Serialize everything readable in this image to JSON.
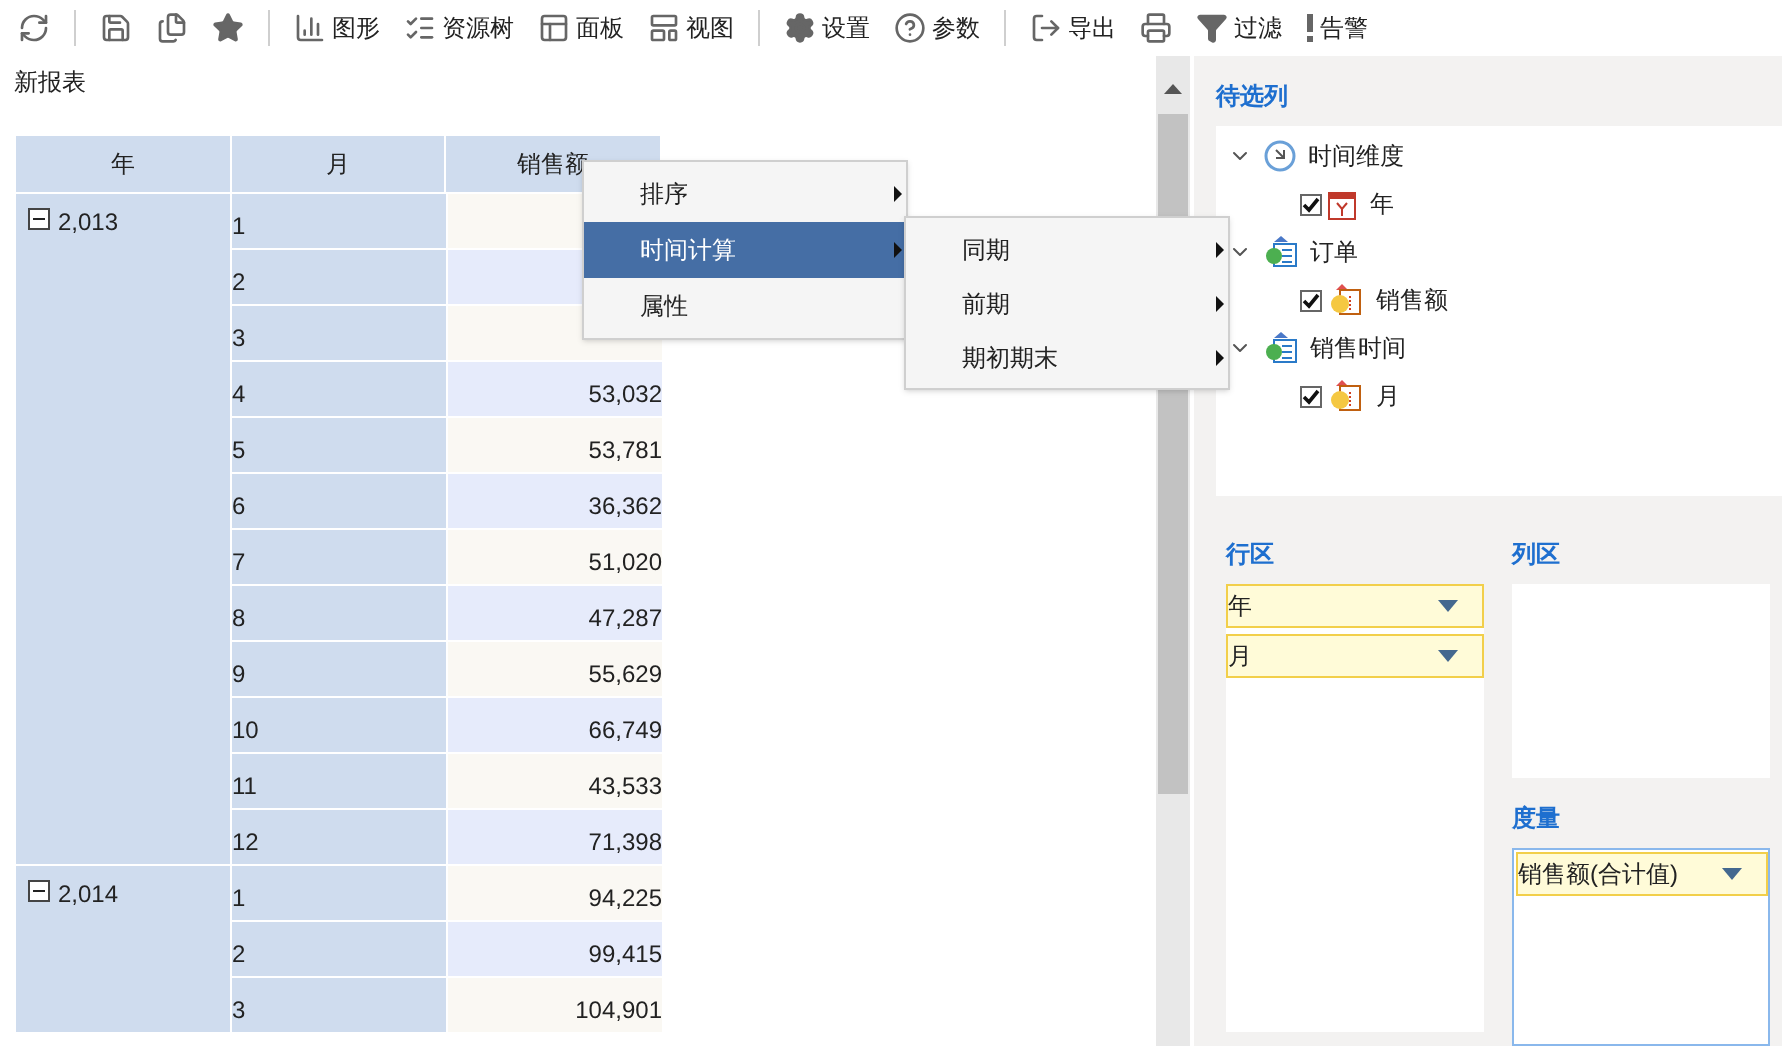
{
  "toolbar": [
    {
      "kind": "refresh"
    },
    {
      "kind": "divider"
    },
    {
      "kind": "save"
    },
    {
      "kind": "save_as"
    },
    {
      "kind": "favorite"
    },
    {
      "kind": "divider"
    },
    {
      "kind": "chart",
      "label": "图形"
    },
    {
      "kind": "tree",
      "label": "资源树"
    },
    {
      "kind": "panel",
      "label": "面板"
    },
    {
      "kind": "view",
      "label": "视图"
    },
    {
      "kind": "divider"
    },
    {
      "kind": "settings",
      "label": "设置"
    },
    {
      "kind": "params",
      "label": "参数"
    },
    {
      "kind": "divider"
    },
    {
      "kind": "export",
      "label": "导出"
    },
    {
      "kind": "print"
    },
    {
      "kind": "filter",
      "label": "过滤"
    },
    {
      "kind": "alert",
      "label": "告警"
    }
  ],
  "report_title": "新报表",
  "table": {
    "columns": [
      "年",
      "月",
      "销售额"
    ],
    "groups": [
      {
        "year": "2,013",
        "expanded": true,
        "rows": [
          {
            "month": "1"
          },
          {
            "month": "2"
          },
          {
            "month": "3"
          },
          {
            "month": "4",
            "value": "53,032"
          },
          {
            "month": "5",
            "value": "53,781"
          },
          {
            "month": "6",
            "value": "36,362"
          },
          {
            "month": "7",
            "value": "51,020"
          },
          {
            "month": "8",
            "value": "47,287"
          },
          {
            "month": "9",
            "value": "55,629"
          },
          {
            "month": "10",
            "value": "66,749"
          },
          {
            "month": "11",
            "value": "43,533"
          },
          {
            "month": "12",
            "value": "71,398"
          }
        ]
      },
      {
        "year": "2,014",
        "expanded": true,
        "rows": [
          {
            "month": "1",
            "value": "94,225"
          },
          {
            "month": "2",
            "value": "99,415"
          },
          {
            "month": "3",
            "value": "104,901"
          }
        ]
      }
    ]
  },
  "context_menu": [
    {
      "label": "排序",
      "submenu": true,
      "selected": false
    },
    {
      "label": "时间计算",
      "submenu": true,
      "selected": true
    },
    {
      "label": "属性",
      "submenu": false,
      "selected": false
    }
  ],
  "submenu": [
    {
      "label": "同期",
      "submenu": true
    },
    {
      "label": "前期",
      "submenu": true
    },
    {
      "label": "期初期末",
      "submenu": true
    }
  ],
  "candidates": {
    "title": "待选列",
    "tree": [
      {
        "label": "时间维度",
        "kind": "time",
        "expanded": true,
        "children": [
          {
            "label": "年",
            "kind": "year",
            "checked": true
          }
        ]
      },
      {
        "label": "订单",
        "kind": "table",
        "expanded": true,
        "children": [
          {
            "label": "销售额",
            "kind": "field",
            "checked": true
          }
        ]
      },
      {
        "label": "销售时间",
        "kind": "table",
        "expanded": true,
        "children": [
          {
            "label": "月",
            "kind": "field",
            "checked": true
          }
        ]
      }
    ]
  },
  "row_zone": {
    "title": "行区",
    "items": [
      "年",
      "月"
    ]
  },
  "column_zone": {
    "title": "列区"
  },
  "measure_zone": {
    "title": "度量",
    "items": [
      "销售额(合计值)"
    ]
  }
}
